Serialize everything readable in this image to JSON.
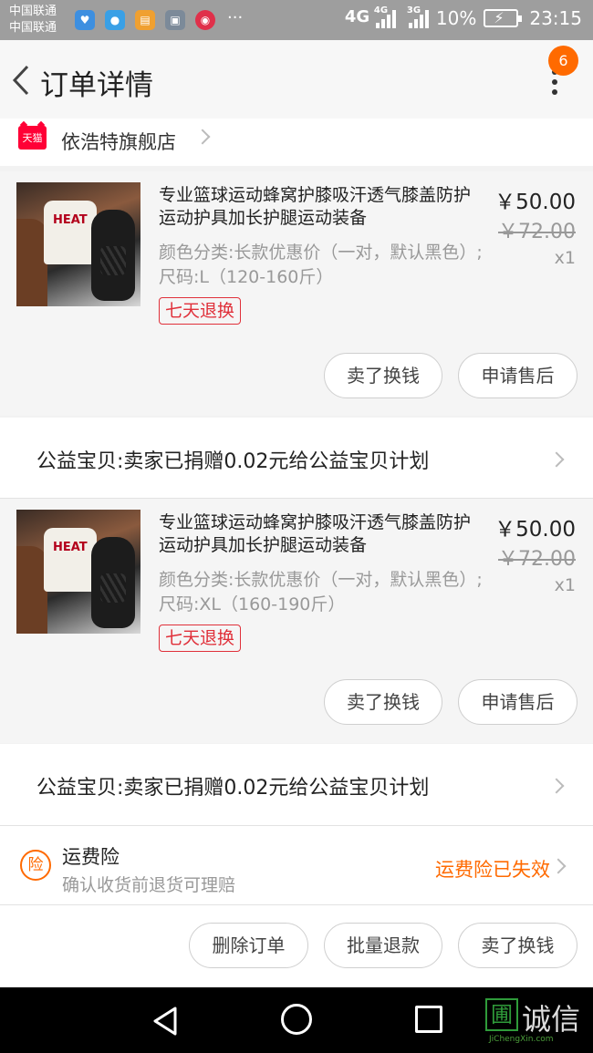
{
  "status_bar": {
    "carrier1": "中国联通",
    "carrier2": "中国联通",
    "dots": "···",
    "net1": "4G",
    "net2": "4G",
    "net3": "3G",
    "battery": "10%",
    "time": "23:15"
  },
  "header": {
    "title": "订单详情",
    "badge": "6"
  },
  "store": {
    "logo_text": "天猫",
    "name": "依浩特旗舰店"
  },
  "items": [
    {
      "title": "专业篮球运动蜂窝护膝吸汗透气膝盖防护运动护具加长护腿运动装备",
      "spec": "颜色分类:长款优惠价（一对，默认黑色）;尺码:L（120-160斤）",
      "tag": "七天退换",
      "price": "￥50.00",
      "original_price": "￥72.00",
      "qty": "x1",
      "btn_sell": "卖了换钱",
      "btn_aftersale": "申请售后"
    },
    {
      "title": "专业篮球运动蜂窝护膝吸汗透气膝盖防护运动护具加长护腿运动装备",
      "spec": "颜色分类:长款优惠价（一对，默认黑色）;尺码:XL（160-190斤）",
      "tag": "七天退换",
      "price": "￥50.00",
      "original_price": "￥72.00",
      "qty": "x1",
      "btn_sell": "卖了换钱",
      "btn_aftersale": "申请售后"
    }
  ],
  "charity": {
    "text": "公益宝贝:卖家已捐赠0.02元给公益宝贝计划"
  },
  "insurance": {
    "icon_text": "险",
    "title": "运费险",
    "subtitle": "确认收货前退货可理赔",
    "status": "运费险已失效"
  },
  "actions": {
    "delete": "删除订单",
    "batch_refund": "批量退款",
    "sell": "卖了换钱"
  },
  "watermark": {
    "box": "圃",
    "text": "诚信",
    "url": "JiChengXin.com"
  },
  "colors": {
    "accent": "#ff6a00",
    "tmall_red": "#ff0036",
    "tag_red": "#e0303a"
  }
}
